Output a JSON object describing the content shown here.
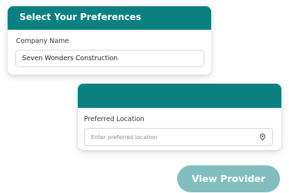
{
  "preferences_card": {
    "title": "Select Your Preferences",
    "company_label": "Company Name",
    "company_value": "Seven Wonders Construction"
  },
  "location_card": {
    "title": "",
    "location_label": "Preferred Location",
    "location_placeholder": "Enter preferred location",
    "location_icon": "location-pin-icon"
  },
  "actions": {
    "view_provider_label": "View Provider"
  },
  "colors": {
    "accent": "#0a8180",
    "button_disabled": "#81bfbe"
  }
}
